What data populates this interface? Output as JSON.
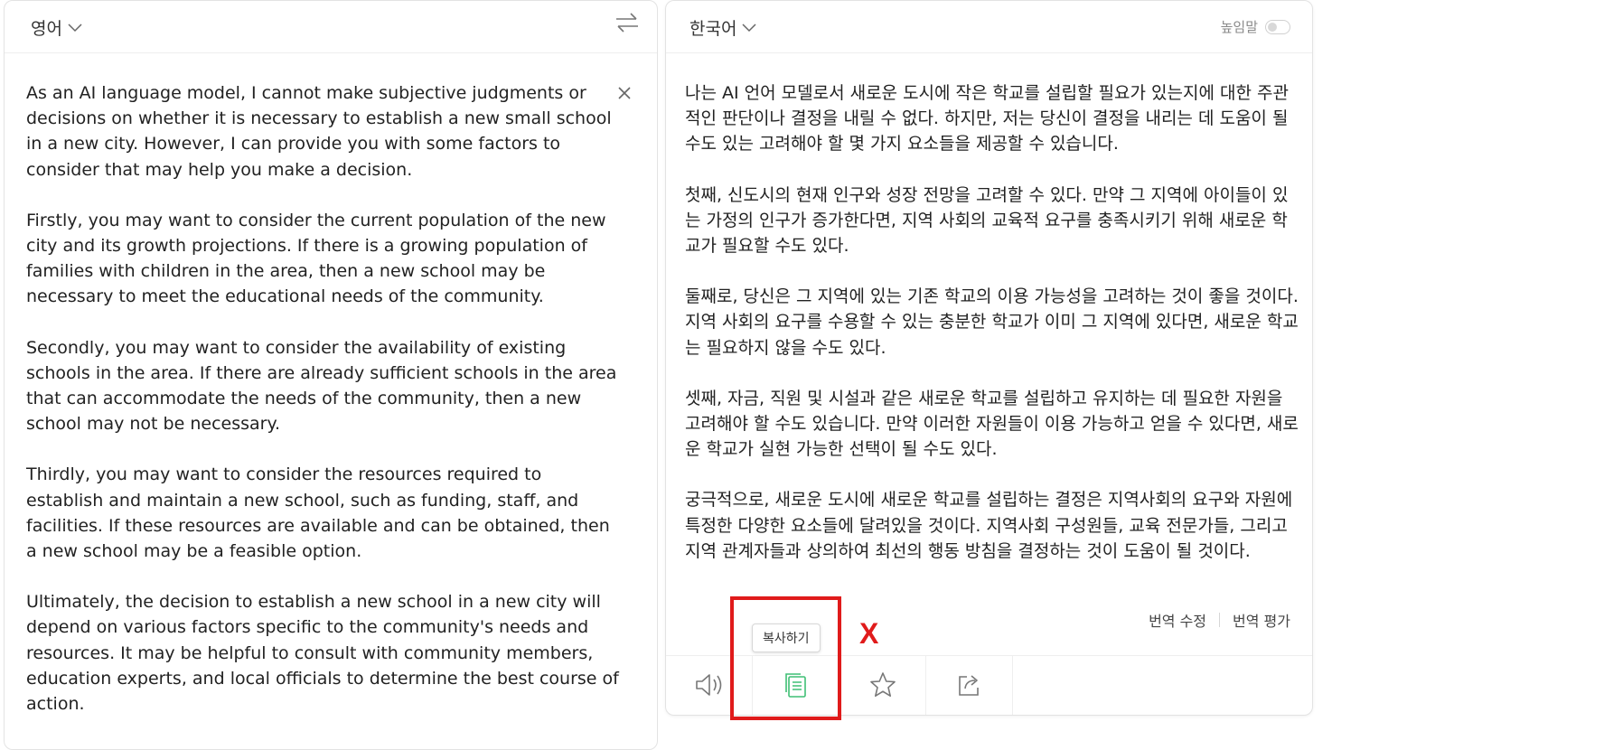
{
  "source": {
    "language": "영어",
    "paragraphs": [
      "As an AI language model, I cannot make subjective judgments or decisions on whether it is necessary to establish a new small school in a new city. However, I can provide you with some factors to consider that may help you make a decision.",
      "Firstly, you may want to consider the current population of the new city and its growth projections. If there is a growing population of families with children in the area, then a new school may be necessary to meet the educational needs of the community.",
      "Secondly, you may want to consider the availability of existing schools in the area. If there are already sufficient schools in the area that can accommodate the needs of the community, then a new school may not be necessary.",
      "Thirdly, you may want to consider the resources required to establish and maintain a new school, such as funding, staff, and facilities. If these resources are available and can be obtained, then a new school may be a feasible option.",
      "Ultimately, the decision to establish a new school in a new city will depend on various factors specific to the community's needs and resources. It may be helpful to consult with community members, education experts, and local officials to determine the best course of action."
    ]
  },
  "target": {
    "language": "한국어",
    "honorific_label": "높임말",
    "honorific_on": false,
    "paragraphs": [
      "나는 AI 언어 모델로서 새로운 도시에 작은 학교를 설립할 필요가 있는지에 대한 주관적인 판단이나 결정을 내릴 수 없다. 하지만, 저는 당신이 결정을 내리는 데 도움이 될 수도 있는 고려해야 할 몇 가지 요소들을 제공할 수 있습니다.",
      "첫째, 신도시의 현재 인구와 성장 전망을 고려할 수 있다. 만약 그 지역에 아이들이 있는 가정의 인구가 증가한다면, 지역 사회의 교육적 요구를 충족시키기 위해 새로운 학교가 필요할 수도 있다.",
      "둘째로, 당신은 그 지역에 있는 기존 학교의 이용 가능성을 고려하는 것이 좋을 것이다. 지역 사회의 요구를 수용할 수 있는 충분한 학교가 이미 그 지역에 있다면, 새로운 학교는 필요하지 않을 수도 있다.",
      "셋째, 자금, 직원 및 시설과 같은 새로운 학교를 설립하고 유지하는 데 필요한 자원을 고려해야 할 수도 있습니다. 만약 이러한 자원들이 이용 가능하고 얻을 수 있다면, 새로운 학교가 실현 가능한 선택이 될 수도 있다.",
      "궁극적으로, 새로운 도시에 새로운 학교를 설립하는 결정은 지역사회의 요구와 자원에 특정한 다양한 요소들에 달려있을 것이다. 지역사회 구성원들, 교육 전문가들, 그리고 지역 관계자들과 상의하여 최선의 행동 방침을 결정하는 것이 도움이 될 것이다."
    ],
    "edit_label": "번역 수정",
    "rate_label": "번역 평가",
    "copy_tooltip": "복사하기"
  },
  "annotation": {
    "mark": "X",
    "color": "#e01b1b"
  },
  "colors": {
    "copy_icon": "#3fbf75",
    "icon_gray": "#777777"
  }
}
